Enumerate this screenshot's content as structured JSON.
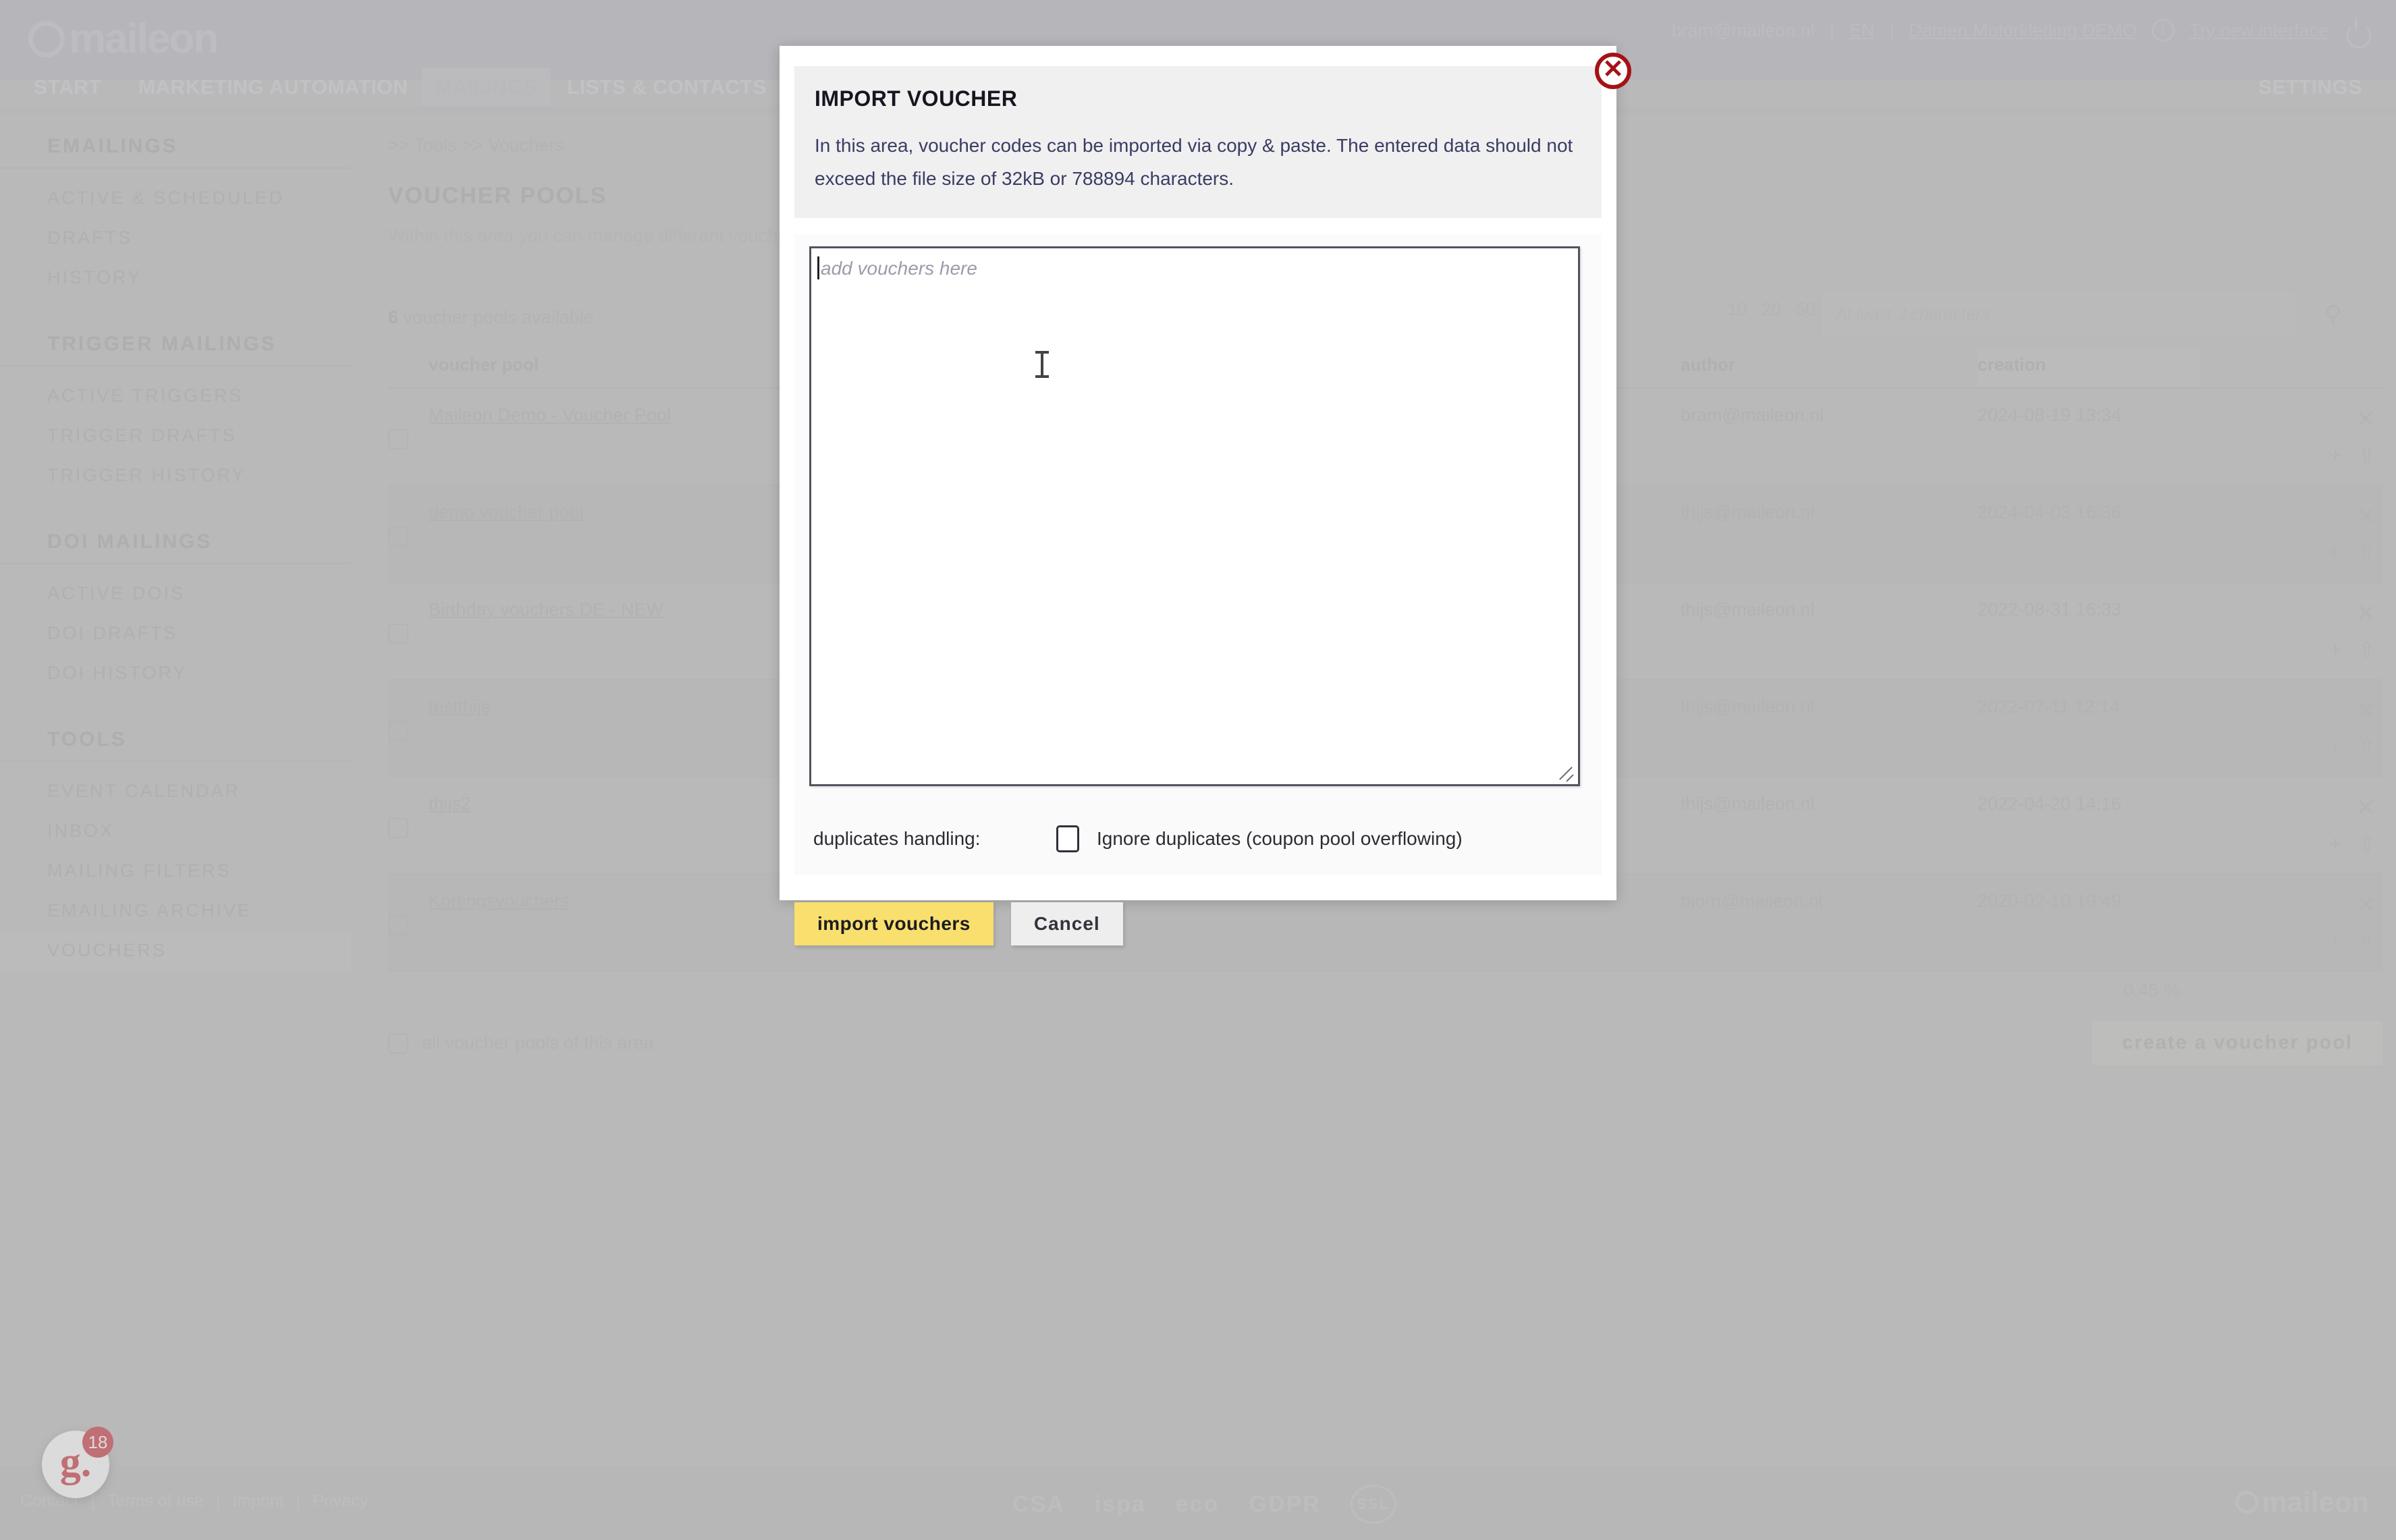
{
  "header": {
    "logo_text": "maileon",
    "user_email": "bram@maileon.nl",
    "language": "EN",
    "account": "Damen Motorkleding DEMO",
    "info_icon": "info-icon",
    "try_new_interface": "Try new interface",
    "power_icon": "power-icon",
    "separator": "|"
  },
  "nav": {
    "items": [
      {
        "label": "START",
        "active": false
      },
      {
        "label": "MARKETING AUTOMATION",
        "active": false
      },
      {
        "label": "MAILINGS",
        "active": true
      },
      {
        "label": "LISTS & CONTACTS",
        "active": false
      },
      {
        "label": "SETTINGS",
        "active": false
      }
    ]
  },
  "sidebar": {
    "groups": [
      {
        "title": "EMAILINGS",
        "items": [
          {
            "label": "ACTIVE & SCHEDULED",
            "active": false
          },
          {
            "label": "DRAFTS",
            "active": false
          },
          {
            "label": "HISTORY",
            "active": false
          }
        ]
      },
      {
        "title": "TRIGGER MAILINGS",
        "items": [
          {
            "label": "ACTIVE TRIGGERS",
            "active": false
          },
          {
            "label": "TRIGGER DRAFTS",
            "active": false
          },
          {
            "label": "TRIGGER HISTORY",
            "active": false
          }
        ]
      },
      {
        "title": "DOI MAILINGS",
        "items": [
          {
            "label": "ACTIVE DOIS",
            "active": false
          },
          {
            "label": "DOI DRAFTS",
            "active": false
          },
          {
            "label": "DOI HISTORY",
            "active": false
          }
        ]
      },
      {
        "title": "TOOLS",
        "items": [
          {
            "label": "EVENT CALENDAR",
            "active": false
          },
          {
            "label": "INBOX",
            "active": false
          },
          {
            "label": "MAILING FILTERS",
            "active": false
          },
          {
            "label": "EMAILING ARCHIVE",
            "active": false
          },
          {
            "label": "VOUCHERS",
            "active": true
          }
        ]
      }
    ]
  },
  "main": {
    "breadcrumb": ">> Tools  >> Vouchers",
    "page_title": "VOUCHER POOLS",
    "page_subtitle": "Within this area you can manage different voucher pools.",
    "available_count": "6",
    "available_label": "voucher pools available",
    "pager": [
      "10",
      "20",
      "50"
    ],
    "search_placeholder": "At least 3 characters",
    "search_value": "",
    "search_icon": "search-icon",
    "table": {
      "columns": [
        "voucher pool",
        "author",
        "creation"
      ],
      "rows": [
        {
          "pool": "Maileon Demo - Voucher Pool",
          "author": "bram@maileon.nl",
          "creation": "2024-08-19 13:34"
        },
        {
          "pool": "demo voucher pool",
          "author": "thijs@maileon.nl",
          "creation": "2024-04-03 16:36"
        },
        {
          "pool": "Birthday vouchers DE - NEW",
          "author": "thijs@maileon.nl",
          "creation": "2022-08-31 16:33"
        },
        {
          "pool": "testthijs",
          "author": "thijs@maileon.nl",
          "creation": "2022-07-11 12:14"
        },
        {
          "pool": "thijs2",
          "author": "thijs@maileon.nl",
          "creation": "2022-04-20 14:16"
        },
        {
          "pool": "Kortingsvouchers",
          "author": "bjorn@maileon.nl",
          "creation": "2020-02-10 19:49"
        }
      ],
      "percent_value": "0.45 %"
    },
    "select_all_label": "all voucher pools of this area",
    "create_button": "create a voucher pool"
  },
  "modal": {
    "title": "IMPORT VOUCHER",
    "description": "In this area, voucher codes can be imported via copy & paste. The entered data should not exceed the file size of 32kB or 788894 characters.",
    "textarea_placeholder": "add vouchers here",
    "textarea_value": "",
    "duplicates_label": "duplicates handling:",
    "duplicates_checkbox_label": "Ignore duplicates (coupon pool overflowing)",
    "duplicates_checked": false,
    "import_button": "import vouchers",
    "cancel_button": "Cancel",
    "close_icon": "close-icon",
    "accent_color": "#f9df6d"
  },
  "footer": {
    "links": [
      "Contact",
      "Terms of use",
      "Imprint",
      "Privacy"
    ],
    "separator": "|",
    "badges": [
      "CSA",
      "ispa",
      "eco",
      "GDPR",
      "SSL"
    ],
    "logo_text": "maileon"
  },
  "chat_widget": {
    "label": "g.",
    "badge_count": "18"
  }
}
